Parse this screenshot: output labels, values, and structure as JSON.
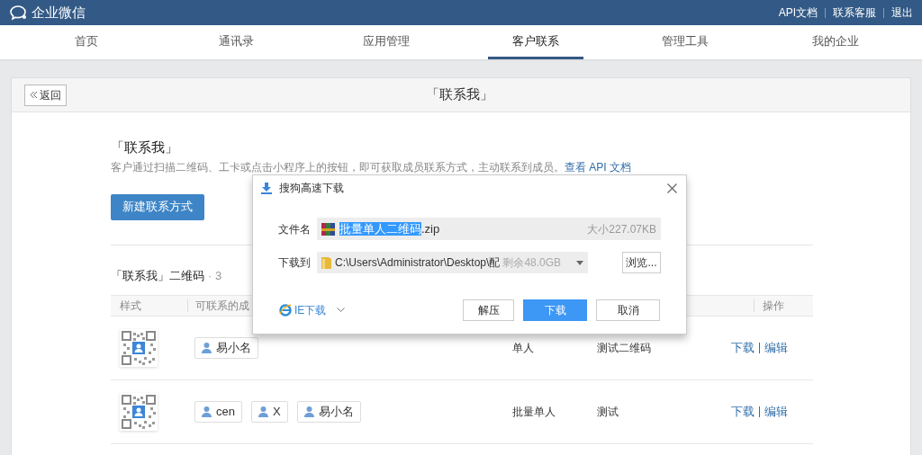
{
  "topbar": {
    "logo_text": "企业微信",
    "links": [
      "API文档",
      "联系客服",
      "退出"
    ]
  },
  "nav": {
    "tabs": [
      {
        "label": "首页",
        "selected": false
      },
      {
        "label": "通讯录",
        "selected": false
      },
      {
        "label": "应用管理",
        "selected": false
      },
      {
        "label": "客户联系",
        "selected": true
      },
      {
        "label": "管理工具",
        "selected": false
      },
      {
        "label": "我的企业",
        "selected": false
      }
    ]
  },
  "page": {
    "back_button": "返回",
    "title": "「联系我」",
    "section_title": "「联系我」",
    "description": "客户通过扫描二维码、工卡或点击小程序上的按钮，即可获取成员联系方式，主动联系到成员。",
    "api_link": "查看 API 文档",
    "new_button": "新建联系方式",
    "list_title": "「联系我」二维码",
    "list_count": "· 3",
    "table": {
      "columns": [
        "样式",
        "可联系的成",
        "操作"
      ],
      "rows": [
        {
          "members": [
            "易小名"
          ],
          "type": "单人",
          "name": "测试二维码",
          "actions": [
            "下载",
            "编辑"
          ]
        },
        {
          "members": [
            "cen",
            "X",
            "易小名"
          ],
          "type": "批量单人",
          "name": "测试",
          "actions": [
            "下载",
            "编辑"
          ]
        }
      ]
    }
  },
  "dialog": {
    "title": "搜狗高速下载",
    "filename_label": "文件名",
    "filename_selected": "批量单人二维码",
    "filename_ext": ".zip",
    "size": "大小227.07KB",
    "path_label": "下载到",
    "path": "C:\\Users\\Administrator\\Desktop\\配",
    "free_space": "剩余48.0GB",
    "browse_button": "浏览...",
    "ie_download": "IE下载",
    "buttons": [
      {
        "label": "解压",
        "primary": false
      },
      {
        "label": "下载",
        "primary": true
      },
      {
        "label": "取消",
        "primary": false
      }
    ]
  }
}
